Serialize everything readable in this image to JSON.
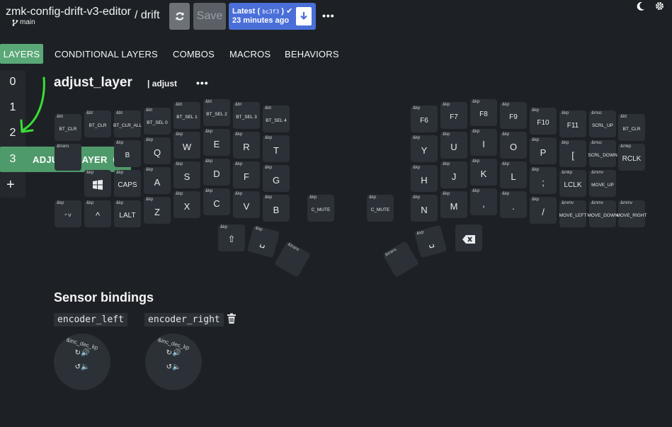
{
  "header": {
    "repo": "zmk-config-drift-v3-editor",
    "branch": "main",
    "keyboard": "/ drift",
    "save_label": "Save",
    "latest_label": "Latest",
    "latest_hash": "bc3f3",
    "latest_ago": "23 minutes ago",
    "more": "•••"
  },
  "tabs": [
    "LAYERS",
    "CONDITIONAL LAYERS",
    "COMBOS",
    "MACROS",
    "BEHAVIORS"
  ],
  "layers": {
    "numbers": [
      "0",
      "1",
      "2"
    ],
    "active_number": "3",
    "active_name": "ADJUST_LAYER",
    "close": "×",
    "add": "+"
  },
  "layer": {
    "title": "adjust_layer",
    "badge": "| adjust",
    "more": "•••"
  },
  "keys": [
    {
      "b": "&bt",
      "p": "BT_CLR",
      "s": "sm"
    },
    {
      "b": "&bt",
      "p": "BT_CLR",
      "s": "sm"
    },
    {
      "b": "&bt",
      "p": "BT_CLR_ALL",
      "s": "sm"
    },
    {
      "b": "&bt",
      "p": "BT_SEL 0",
      "s": "sm"
    },
    {
      "b": "&bt",
      "p": "BT_SEL 1",
      "s": "sm"
    },
    {
      "b": "&bt",
      "p": "BT_SEL 2",
      "s": "sm"
    },
    {
      "b": "&bt",
      "p": "BT_SEL 3",
      "s": "sm"
    },
    {
      "b": "&bt",
      "p": "BT_SEL 4",
      "s": "sm"
    },
    {
      "b": "&kp",
      "p": "F6",
      "s": "med"
    },
    {
      "b": "&kp",
      "p": "F7",
      "s": "med"
    },
    {
      "b": "&kp",
      "p": "F8",
      "s": "med"
    },
    {
      "b": "&kp",
      "p": "F9",
      "s": "med"
    },
    {
      "b": "&kp",
      "p": "F10",
      "s": "med"
    },
    {
      "b": "&kp",
      "p": "F11",
      "s": "med"
    },
    {
      "b": "&msc",
      "p": "SCRL_UP",
      "s": "sm"
    },
    {
      "b": "&bt",
      "p": "BT_CLR",
      "s": "sm"
    },
    {
      "b": "&trans",
      "p": "",
      "s": "sm"
    },
    {
      "b": "&kp",
      "p": "B",
      "s": "med"
    },
    {
      "b": "&kp",
      "p": "Q",
      "s": "big"
    },
    {
      "b": "&kp",
      "p": "W",
      "s": "big"
    },
    {
      "b": "&kp",
      "p": "E",
      "s": "big"
    },
    {
      "b": "&kp",
      "p": "R",
      "s": "big"
    },
    {
      "b": "&kp",
      "p": "T",
      "s": "big"
    },
    {
      "b": "&kp",
      "p": "Y",
      "s": "big"
    },
    {
      "b": "&kp",
      "p": "U",
      "s": "big"
    },
    {
      "b": "&kp",
      "p": "I",
      "s": "big"
    },
    {
      "b": "&kp",
      "p": "O",
      "s": "big"
    },
    {
      "b": "&kp",
      "p": "P",
      "s": "big"
    },
    {
      "b": "&kp",
      "p": "[",
      "s": "big"
    },
    {
      "b": "&msc",
      "p": "SCRL_DOWN",
      "s": "sm"
    },
    {
      "b": "&mkp",
      "p": "RCLK",
      "s": "med"
    },
    {
      "b": "&kp",
      "p": "",
      "s": "big",
      "icon": "windows"
    },
    {
      "b": "&kp",
      "p": "CAPS",
      "s": "med"
    },
    {
      "b": "&kp",
      "p": "A",
      "s": "big"
    },
    {
      "b": "&kp",
      "p": "S",
      "s": "big"
    },
    {
      "b": "&kp",
      "p": "D",
      "s": "big"
    },
    {
      "b": "&kp",
      "p": "F",
      "s": "big"
    },
    {
      "b": "&kp",
      "p": "G",
      "s": "big"
    },
    {
      "b": "&kp",
      "p": "H",
      "s": "big"
    },
    {
      "b": "&kp",
      "p": "J",
      "s": "big"
    },
    {
      "b": "&kp",
      "p": "K",
      "s": "big"
    },
    {
      "b": "&kp",
      "p": "L",
      "s": "big"
    },
    {
      "b": "&kp",
      "p": ";",
      "s": "big"
    },
    {
      "b": "&mkp",
      "p": "LCLK",
      "s": "med"
    },
    {
      "b": "&mmv",
      "p": "MOVE_UP",
      "s": "sm"
    },
    {
      "b": "&kp",
      "p": "^ V",
      "s": "sm"
    },
    {
      "b": "&kp",
      "p": "^",
      "s": "big"
    },
    {
      "b": "&kp",
      "p": "LALT",
      "s": "med"
    },
    {
      "b": "&kp",
      "p": "Z",
      "s": "big"
    },
    {
      "b": "&kp",
      "p": "X",
      "s": "big"
    },
    {
      "b": "&kp",
      "p": "C",
      "s": "big"
    },
    {
      "b": "&kp",
      "p": "V",
      "s": "big"
    },
    {
      "b": "&kp",
      "p": "B",
      "s": "big"
    },
    {
      "b": "&kp",
      "p": "C_MUTE",
      "s": "sm"
    },
    {
      "b": "&kp",
      "p": "C_MUTE",
      "s": "sm"
    },
    {
      "b": "&kp",
      "p": "N",
      "s": "big"
    },
    {
      "b": "&kp",
      "p": "M",
      "s": "big"
    },
    {
      "b": "&kp",
      "p": ",",
      "s": "big"
    },
    {
      "b": "&kp",
      "p": ".",
      "s": "big"
    },
    {
      "b": "&kp",
      "p": "/",
      "s": "big"
    },
    {
      "b": "&mmv",
      "p": "MOVE_LEFT",
      "s": "sm"
    },
    {
      "b": "&mmv",
      "p": "MOVE_DOWN",
      "s": "sm"
    },
    {
      "b": "&mmv",
      "p": "MOVE_RIGHT",
      "s": "sm"
    },
    {
      "b": "&kp",
      "p": "⇧",
      "s": "big"
    },
    {
      "b": "&kp",
      "p": "␣",
      "s": "big"
    },
    {
      "b": "&trans",
      "p": "",
      "s": "sm"
    },
    {
      "b": "&trans",
      "p": "",
      "s": "sm"
    },
    {
      "b": "&kp",
      "p": "␣",
      "s": "big"
    },
    {
      "b": "",
      "p": "",
      "s": "big",
      "icon": "backspace"
    }
  ],
  "sensors": {
    "title": "Sensor bindings",
    "encoders": [
      {
        "label": "encoder_left",
        "binding": "&inc_dec_kp",
        "cw": "↻🔊",
        "ccw": "↺🔈"
      },
      {
        "label": "encoder_right",
        "binding": "&inc_dec_kp",
        "cw": "↻🔊",
        "ccw": "↺🔈"
      }
    ]
  }
}
